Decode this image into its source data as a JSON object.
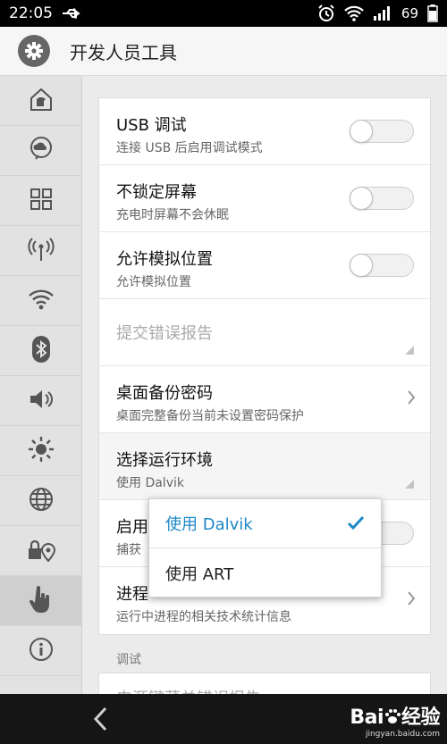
{
  "status_bar": {
    "time": "22:05",
    "battery": "69"
  },
  "header": {
    "title": "开发人员工具"
  },
  "sidebar": {
    "items": [
      {
        "icon": "home-shirt-icon"
      },
      {
        "icon": "cloud-chat-icon"
      },
      {
        "icon": "grid-icon"
      },
      {
        "icon": "antenna-icon"
      },
      {
        "icon": "wifi-icon"
      },
      {
        "icon": "bluetooth-icon"
      },
      {
        "icon": "volume-icon"
      },
      {
        "icon": "brightness-icon"
      },
      {
        "icon": "globe-icon"
      },
      {
        "icon": "lock-location-icon"
      },
      {
        "icon": "hand-pointer-icon",
        "active": true
      },
      {
        "icon": "info-icon"
      }
    ]
  },
  "settings": {
    "usb_debug": {
      "title": "USB 调试",
      "subtitle": "连接 USB 后启用调试模式",
      "enabled": false
    },
    "stay_awake": {
      "title": "不锁定屏幕",
      "subtitle": "充电时屏幕不会休眠",
      "enabled": false
    },
    "mock_location": {
      "title": "允许模拟位置",
      "subtitle": "允许模拟位置",
      "enabled": false
    },
    "bug_report": {
      "title": "提交错误报告"
    },
    "backup_password": {
      "title": "桌面备份密码",
      "subtitle": "桌面完整备份当前未设置密码保护"
    },
    "runtime": {
      "title": "选择运行环境",
      "subtitle": "使用 Dalvik"
    },
    "hidden_row": {
      "title": "启用",
      "subtitle": "捕获"
    },
    "process_stats": {
      "title": "进程",
      "subtitle": "运行中进程的相关技术统计信息"
    }
  },
  "section": {
    "debug_label": "调试",
    "power_menu_bug_report": "电源键菜单错误报告"
  },
  "runtime_popup": {
    "options": [
      "使用 Dalvik",
      "使用 ART"
    ],
    "selected": "使用 Dalvik"
  },
  "watermark": {
    "brand": "Bai",
    "brand_suffix": "经验",
    "url": "jingyan.baidu.com"
  },
  "colors": {
    "accent": "#1e88c7",
    "statusbar": "#000000",
    "navbar": "#151515"
  }
}
